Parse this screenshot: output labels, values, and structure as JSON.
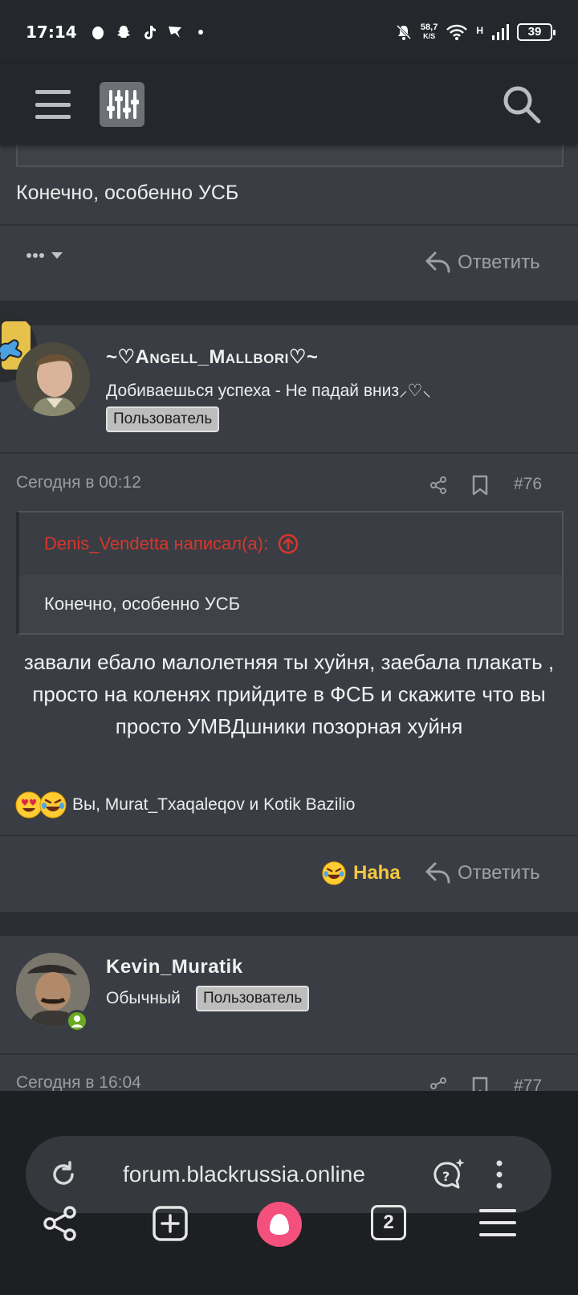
{
  "status_bar": {
    "time": "17:14",
    "net_speed_value": "58,7",
    "net_speed_unit": "K/S",
    "network_type": "H",
    "battery": "39",
    "icons": [
      "bug-icon",
      "snapchat-icon",
      "tiktok-icon",
      "flag-icon",
      "dot-icon",
      "bell-off-icon",
      "wifi-icon",
      "signal-icon",
      "battery-icon"
    ]
  },
  "app_header": {
    "icons": [
      "menu-icon",
      "filter-icon",
      "search-icon"
    ]
  },
  "prev_post": {
    "body": "Конечно, особенно УСБ",
    "reply_label": "Ответить"
  },
  "post_76": {
    "username": "~♡Angell_Mallbori♡~",
    "status_line": "Добиваешься успеха - Не падай вниз⸝♡⸜",
    "role": "Пользователь",
    "timestamp": "Сегодня в 00:12",
    "number": "#76",
    "quote_author": "Denis_Vendetta написал(а):",
    "quote_text": "Конечно, особенно УСБ",
    "body": "завали ебало малолетняя ты хуйня, заебала плакать , просто на коленях прийдите в ФСБ и скажите что вы просто УМВДшники позорная хуйня",
    "reactions_text": "Вы, Murat_Txaqaleqov и Kotik Bazilio",
    "reaction_icons": [
      "heart-eyes-emoji",
      "rofl-emoji"
    ],
    "reaction_button": "Haha",
    "reply_label": "Ответить",
    "colors": {
      "reaction_accent": "#f5c842",
      "quote_author": "#d6372c"
    }
  },
  "post_77": {
    "username": "Kevin_Muratik",
    "title": "Обычный",
    "role": "Пользователь",
    "timestamp": "Сегодня в 16:04",
    "number": "#77"
  },
  "browser": {
    "url": "forum.blackrussia.online",
    "tab_count": "2",
    "nav_icons": [
      "share-icon",
      "new-tab-icon",
      "alice-icon",
      "tabs-icon",
      "menu-icon"
    ]
  }
}
